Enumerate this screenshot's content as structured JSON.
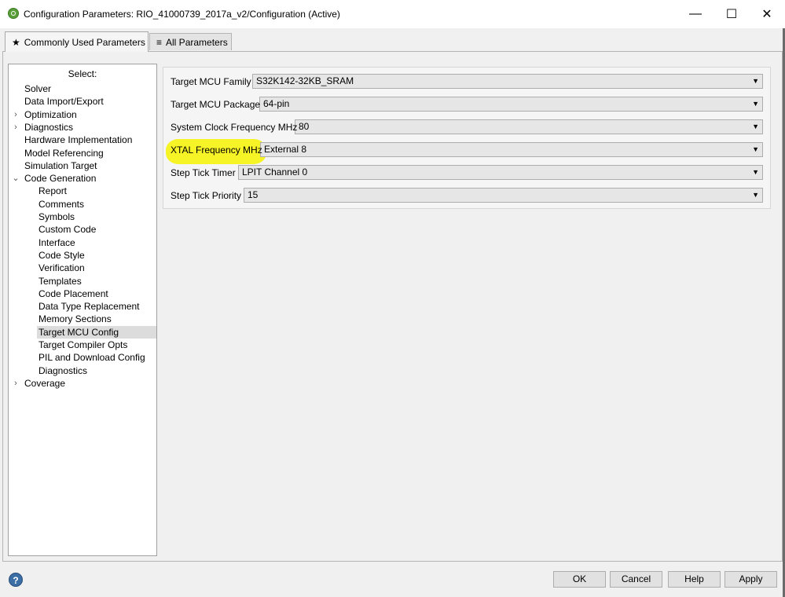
{
  "window": {
    "title": "Configuration Parameters: RIO_41000739_2017a_v2/Configuration (Active)",
    "controls": {
      "minimize": "—",
      "maximize": "☐",
      "close": "✕"
    }
  },
  "tabs": [
    {
      "label": "Commonly Used Parameters",
      "icon": "star-icon",
      "glyph": "★",
      "active": true
    },
    {
      "label": "All Parameters",
      "icon": "list-icon",
      "glyph": "≡",
      "active": false
    }
  ],
  "tree": {
    "header": "Select:",
    "items": [
      {
        "label": "Solver",
        "level": 0,
        "expander": ""
      },
      {
        "label": "Data Import/Export",
        "level": 0,
        "expander": ""
      },
      {
        "label": "Optimization",
        "level": 0,
        "expander": "›"
      },
      {
        "label": "Diagnostics",
        "level": 0,
        "expander": "›"
      },
      {
        "label": "Hardware Implementation",
        "level": 0,
        "expander": ""
      },
      {
        "label": "Model Referencing",
        "level": 0,
        "expander": ""
      },
      {
        "label": "Simulation Target",
        "level": 0,
        "expander": ""
      },
      {
        "label": "Code Generation",
        "level": 0,
        "expander": "⌄"
      },
      {
        "label": "Report",
        "level": 1
      },
      {
        "label": "Comments",
        "level": 1
      },
      {
        "label": "Symbols",
        "level": 1
      },
      {
        "label": "Custom Code",
        "level": 1
      },
      {
        "label": "Interface",
        "level": 1
      },
      {
        "label": "Code Style",
        "level": 1
      },
      {
        "label": "Verification",
        "level": 1
      },
      {
        "label": "Templates",
        "level": 1
      },
      {
        "label": "Code Placement",
        "level": 1
      },
      {
        "label": "Data Type Replacement",
        "level": 1
      },
      {
        "label": "Memory Sections",
        "level": 1
      },
      {
        "label": "Target MCU Config",
        "level": 1,
        "selected": true
      },
      {
        "label": "Target Compiler Opts",
        "level": 1
      },
      {
        "label": "PIL and Download Config",
        "level": 1
      },
      {
        "label": "Diagnostics",
        "level": 1
      },
      {
        "label": "Coverage",
        "level": 0,
        "expander": "›"
      }
    ]
  },
  "params": [
    {
      "label": "Target MCU Family",
      "value": "S32K142-32KB_SRAM"
    },
    {
      "label": "Target MCU Package",
      "value": "64-pin"
    },
    {
      "label": "System Clock Frequency MHz",
      "value": "80"
    },
    {
      "label": "XTAL Frequency MHz",
      "value": "External 8",
      "highlighted": true
    },
    {
      "label": "Step Tick Timer",
      "value": "LPIT Channel 0"
    },
    {
      "label": "Step Tick Priority",
      "value": "15"
    }
  ],
  "buttons": {
    "help_icon": "?",
    "ok": "OK",
    "cancel": "Cancel",
    "help": "Help",
    "apply": "Apply"
  },
  "colors": {
    "highlight": "#f5f21a",
    "selected_row": "#dcdcdc"
  }
}
